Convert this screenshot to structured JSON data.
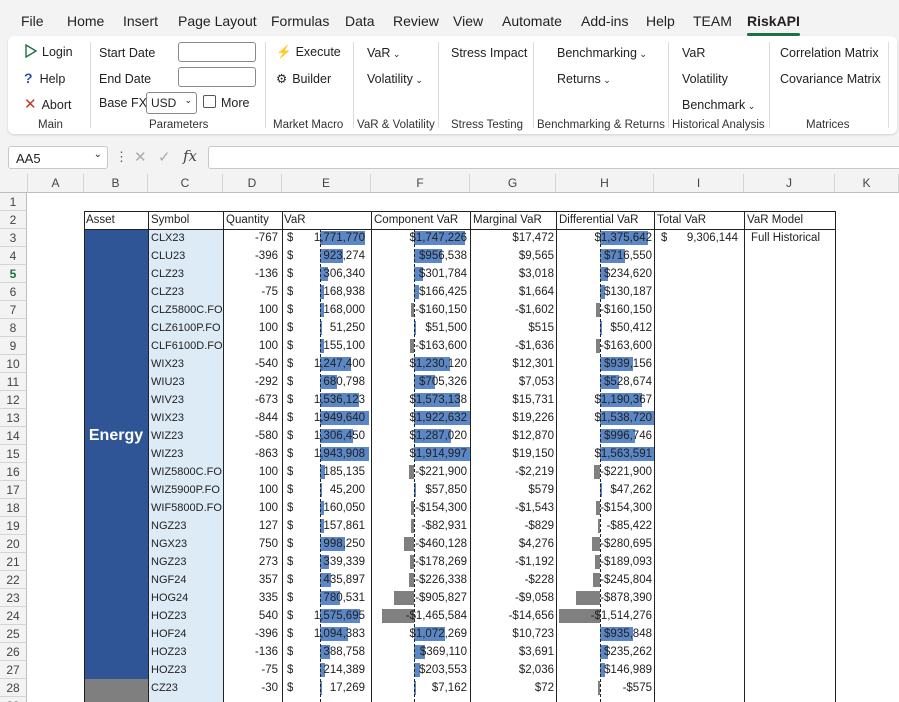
{
  "menu": [
    "File",
    "Home",
    "Insert",
    "Page Layout",
    "Formulas",
    "Data",
    "Review",
    "View",
    "Automate",
    "Add-ins",
    "Help",
    "TEAM",
    "RiskAPI"
  ],
  "ribbon": {
    "main": {
      "login": "Login",
      "help": "Help",
      "abort": "Abort",
      "label": "Main"
    },
    "parameters": {
      "start_date": "Start Date",
      "end_date": "End Date",
      "base_fx": "Base FX:",
      "fx_value": "USD",
      "more": "More",
      "label": "Parameters"
    },
    "market_macro": {
      "execute": "Execute",
      "builder": "Builder",
      "label": "Market Macro"
    },
    "var_vol": {
      "var": "VaR",
      "volatility": "Volatility",
      "label": "VaR & Volatility"
    },
    "stress": {
      "stress_impact": "Stress Impact",
      "label": "Stress Testing"
    },
    "bench": {
      "benchmarking": "Benchmarking",
      "returns": "Returns",
      "label": "Benchmarking & Returns"
    },
    "hist": {
      "var": "VaR",
      "volatility": "Volatility",
      "benchmark": "Benchmark",
      "label": "Historical Analysis"
    },
    "matrices": {
      "correlation": "Correlation Matrix",
      "covariance": "Covariance Matrix",
      "label": "Matrices"
    }
  },
  "name_box": "AA5",
  "fx_symbol": "fx",
  "columns": [
    "A",
    "B",
    "C",
    "D",
    "E",
    "F",
    "G",
    "H",
    "I",
    "J",
    "K"
  ],
  "headers": {
    "asset": "Asset",
    "symbol": "Symbol",
    "quantity": "Quantity",
    "var": "VaR",
    "component_var": "Component VaR",
    "marginal_var": "Marginal VaR",
    "differential_var": "Differential VaR",
    "total_var": "Total VaR",
    "var_model": "VaR Model"
  },
  "asset_group": "Energy",
  "total_var": "9,306,144",
  "total_var_currency": "$",
  "var_model": "Full Historical",
  "selected_row": 5,
  "colors": {
    "asset_blue": "#2f5597",
    "symbol_fill": "#ddebf7",
    "pos_bar": "#5b87c6",
    "neg_bar": "#808080",
    "accent": "#1e7145"
  },
  "rows": [
    {
      "sym": "CLX23",
      "qty": "-767",
      "var": "1,771,770",
      "varv": 1771770,
      "comp": "$1,747,226",
      "compv": 1747226,
      "marg": "$17,472",
      "diff": "$1,375,642",
      "diffv": 1375642
    },
    {
      "sym": "CLU23",
      "qty": "-396",
      "var": "923,274",
      "varv": 923274,
      "comp": "$956,538",
      "compv": 956538,
      "marg": "$9,565",
      "diff": "$716,550",
      "diffv": 716550
    },
    {
      "sym": "CLZ23",
      "qty": "-136",
      "var": "306,340",
      "varv": 306340,
      "comp": "$301,784",
      "compv": 301784,
      "marg": "$3,018",
      "diff": "$234,620",
      "diffv": 234620
    },
    {
      "sym": "CLZ23",
      "qty": "-75",
      "var": "168,938",
      "varv": 168938,
      "comp": "$166,425",
      "compv": 166425,
      "marg": "$1,664",
      "diff": "$130,187",
      "diffv": 130187
    },
    {
      "sym": "CLZ5800C.FO",
      "qty": "100",
      "var": "168,000",
      "varv": 168000,
      "comp": "-$160,150",
      "compv": -160150,
      "marg": "-$1,602",
      "diff": "-$160,150",
      "diffv": -160150
    },
    {
      "sym": "CLZ6100P.FO",
      "qty": "100",
      "var": "51,250",
      "varv": 51250,
      "comp": "$51,500",
      "compv": 51500,
      "marg": "$515",
      "diff": "$50,412",
      "diffv": 50412
    },
    {
      "sym": "CLF6100D.FO",
      "qty": "100",
      "var": "155,100",
      "varv": 155100,
      "comp": "-$163,600",
      "compv": -163600,
      "marg": "-$1,636",
      "diff": "-$163,600",
      "diffv": -163600
    },
    {
      "sym": "WIX23",
      "qty": "-540",
      "var": "1,247,400",
      "varv": 1247400,
      "comp": "$1,230,120",
      "compv": 1230120,
      "marg": "$12,301",
      "diff": "$939,156",
      "diffv": 939156
    },
    {
      "sym": "WIU23",
      "qty": "-292",
      "var": "680,798",
      "varv": 680798,
      "comp": "$705,326",
      "compv": 705326,
      "marg": "$7,053",
      "diff": "$528,674",
      "diffv": 528674
    },
    {
      "sym": "WIV23",
      "qty": "-673",
      "var": "1,536,123",
      "varv": 1536123,
      "comp": "$1,573,138",
      "compv": 1573138,
      "marg": "$15,731",
      "diff": "$1,190,367",
      "diffv": 1190367
    },
    {
      "sym": "WIX23",
      "qty": "-844",
      "var": "1,949,640",
      "varv": 1949640,
      "comp": "$1,922,632",
      "compv": 1922632,
      "marg": "$19,226",
      "diff": "$1,538,720",
      "diffv": 1538720
    },
    {
      "sym": "WIZ23",
      "qty": "-580",
      "var": "1,306,450",
      "varv": 1306450,
      "comp": "$1,287,020",
      "compv": 1287020,
      "marg": "$12,870",
      "diff": "$996,746",
      "diffv": 996746
    },
    {
      "sym": "WIZ23",
      "qty": "-863",
      "var": "1,943,908",
      "varv": 1943908,
      "comp": "$1,914,997",
      "compv": 1914997,
      "marg": "$19,150",
      "diff": "$1,563,591",
      "diffv": 1563591
    },
    {
      "sym": "WIZ5800C.FO",
      "qty": "100",
      "var": "185,135",
      "varv": 185135,
      "comp": "-$221,900",
      "compv": -221900,
      "marg": "-$2,219",
      "diff": "-$221,900",
      "diffv": -221900
    },
    {
      "sym": "WIZ5900P.FO",
      "qty": "100",
      "var": "45,200",
      "varv": 45200,
      "comp": "$57,850",
      "compv": 57850,
      "marg": "$579",
      "diff": "$47,262",
      "diffv": 47262
    },
    {
      "sym": "WIF5800D.FO",
      "qty": "100",
      "var": "160,050",
      "varv": 160050,
      "comp": "-$154,300",
      "compv": -154300,
      "marg": "-$1,543",
      "diff": "-$154,300",
      "diffv": -154300
    },
    {
      "sym": "NGZ23",
      "qty": "127",
      "var": "157,861",
      "varv": 157861,
      "comp": "-$82,931",
      "compv": -82931,
      "marg": "-$829",
      "diff": "-$85,422",
      "diffv": -85422
    },
    {
      "sym": "NGX23",
      "qty": "750",
      "var": "998,250",
      "varv": 998250,
      "comp": "-$460,128",
      "compv": -460128,
      "marg": "$4,276",
      "diff": "-$280,695",
      "diffv": -280695
    },
    {
      "sym": "NGZ23",
      "qty": "273",
      "var": "339,339",
      "varv": 339339,
      "comp": "-$178,269",
      "compv": -178269,
      "marg": "-$1,192",
      "diff": "-$189,093",
      "diffv": -189093
    },
    {
      "sym": "NGF24",
      "qty": "357",
      "var": "435,897",
      "varv": 435897,
      "comp": "-$226,338",
      "compv": -226338,
      "marg": "-$228",
      "diff": "-$245,804",
      "diffv": -245804
    },
    {
      "sym": "HOG24",
      "qty": "335",
      "var": "780,531",
      "varv": 780531,
      "comp": "-$905,827",
      "compv": -905827,
      "marg": "-$9,058",
      "diff": "-$878,390",
      "diffv": -878390
    },
    {
      "sym": "HOZ23",
      "qty": "540",
      "var": "1,575,695",
      "varv": 1575695,
      "comp": "-$1,465,584",
      "compv": -1465584,
      "marg": "-$14,656",
      "diff": "-$1,514,276",
      "diffv": -1514276
    },
    {
      "sym": "HOF24",
      "qty": "-396",
      "var": "1,094,383",
      "varv": 1094383,
      "comp": "$1,072,269",
      "compv": 1072269,
      "marg": "$10,723",
      "diff": "$935,848",
      "diffv": 935848
    },
    {
      "sym": "HOZ23",
      "qty": "-136",
      "var": "388,758",
      "varv": 388758,
      "comp": "$369,110",
      "compv": 369110,
      "marg": "$3,691",
      "diff": "$235,262",
      "diffv": 235262
    },
    {
      "sym": "HOZ23",
      "qty": "-75",
      "var": "214,389",
      "varv": 214389,
      "comp": "$203,553",
      "compv": 203553,
      "marg": "$2,036",
      "diff": "$146,989",
      "diffv": 146989
    },
    {
      "sym": "CZ23",
      "qty": "-30",
      "var": "17,269",
      "varv": 17269,
      "comp": "$7,162",
      "compv": 7162,
      "marg": "$72",
      "diff": "-$575",
      "diffv": -575
    }
  ]
}
